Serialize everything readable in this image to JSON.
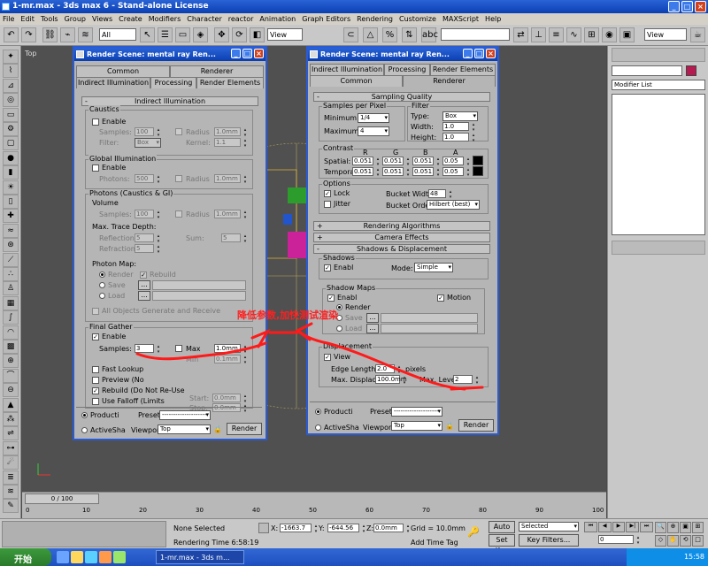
{
  "app": {
    "title": "1-mr.max - 3ds max 6 - Stand-alone License",
    "menu": [
      "File",
      "Edit",
      "Tools",
      "Group",
      "Views",
      "Create",
      "Modifiers",
      "Character",
      "reactor",
      "Animation",
      "Graph Editors",
      "Rendering",
      "Customize",
      "MAXScript",
      "Help"
    ]
  },
  "toolbar": {
    "selection_filter": "All",
    "ref_coord": "View",
    "right_view": "View"
  },
  "viewport": {
    "label": "Top"
  },
  "cmdpanel": {
    "modifier_list": "Modifier List"
  },
  "timeline": {
    "frame": "0 / 100",
    "ticks": [
      "0",
      "10",
      "20",
      "30",
      "40",
      "50",
      "60",
      "70",
      "80",
      "90",
      "100"
    ]
  },
  "status": {
    "selection": "None Selected",
    "prompt": "Rendering Time  6:58:19",
    "x": "-1663.7",
    "y": "-644.56",
    "z": "0.0mm",
    "grid": "Grid = 10.0mm",
    "add_time_tag": "Add Time Tag",
    "auto_key": "Auto Key",
    "selected": "Selected",
    "set_key": "Set Key",
    "key_filters": "Key Filters...",
    "frame_field": "0"
  },
  "taskbar": {
    "start": "开始",
    "task": "1-mr.max - 3ds m...",
    "clock": "15:58"
  },
  "dlg1": {
    "title": "Render Scene: mental ray Ren...",
    "tabs_top": [
      "Common",
      "Renderer"
    ],
    "tabs_bottom": [
      "Indirect Illumination",
      "Processing",
      "Render Elements"
    ],
    "rollout": "Indirect Illumination",
    "caustics": {
      "label": "Caustics",
      "enable": "Enable",
      "samples_label": "Samples:",
      "samples": "100",
      "radius_label": "Radius",
      "radius": "1.0mm",
      "filter_label": "Filter:",
      "filter": "Box",
      "kernel_label": "Kernel:",
      "kernel": "1.1"
    },
    "gi": {
      "label": "Global Illumination",
      "enable": "Enable",
      "photons_label": "Photons:",
      "photons": "500",
      "radius_label": "Radius",
      "radius": "1.0mm"
    },
    "photons": {
      "label": "Photons (Caustics & GI)",
      "volume": "Volume",
      "samples_label": "Samples:",
      "samples": "100",
      "radius_label": "Radius",
      "radius": "1.0mm",
      "max_trace": "Max. Trace Depth:",
      "reflections_label": "Reflections:",
      "reflections": "5",
      "sum_label": "Sum:",
      "sum": "5",
      "refractions_label": "Refractions:",
      "refractions": "5",
      "photon_map": "Photon Map:",
      "render": "Render",
      "rebuild": "Rebuild",
      "save": "Save",
      "load": "Load",
      "browse": "...",
      "all_objects": "All Objects Generate and Receive"
    },
    "fg": {
      "label": "Final Gather",
      "enable": "Enable",
      "samples_label": "Samples:",
      "samples": "3",
      "max_label": "Max",
      "max": "1.0mm",
      "min_label": "Min",
      "min": "0.1mm",
      "fast_lookup": "Fast Lookup",
      "preview": "Preview (No",
      "rebuild": "Rebuild (Do Not Re-Use",
      "use_falloff": "Use Falloff (Limits",
      "start_label": "Start:",
      "start": "0.0mm",
      "stop_label": "Stop:",
      "stop": "0.0mm"
    },
    "bottom": {
      "production": "Producti",
      "activeshade": "ActiveSha",
      "preset_label": "Preset:",
      "preset": "--------------------",
      "viewport_label": "Viewport:",
      "viewport": "Top",
      "render": "Render"
    }
  },
  "dlg2": {
    "title": "Render Scene: mental ray Ren...",
    "tabs_top": [
      "Indirect Illumination",
      "Processing",
      "Render Elements"
    ],
    "tabs_bottom": [
      "Common",
      "Renderer"
    ],
    "rollout": "Sampling Quality",
    "spp": {
      "label": "Samples per Pixel",
      "min_label": "Minimum:",
      "min": "1/4",
      "max_label": "Maximum:",
      "max": "4"
    },
    "filter": {
      "label": "Filter",
      "type_label": "Type:",
      "type": "Box",
      "width_label": "Width:",
      "width": "1.0",
      "height_label": "Height:",
      "height": "1.0"
    },
    "contrast": {
      "label": "Contrast",
      "cols": [
        "R",
        "G",
        "B",
        "A"
      ],
      "spatial_label": "Spatial:",
      "spatial": [
        "0.051",
        "0.051",
        "0.051",
        "0.05"
      ],
      "temporal_label": "Temporal:",
      "temporal": [
        "0.051",
        "0.051",
        "0.051",
        "0.05"
      ]
    },
    "options": {
      "label": "Options",
      "lock": "Lock",
      "jitter": "Jitter",
      "bucket_width_label": "Bucket Width:",
      "bucket_width": "48",
      "bucket_order_label": "Bucket Order:",
      "bucket_order": "Hilbert (best)"
    },
    "rollouts": [
      "Rendering Algorithms",
      "Camera Effects",
      "Shadows & Displacement"
    ],
    "shadows": {
      "label": "Shadows",
      "enable": "Enabl",
      "mode_label": "Mode:",
      "mode": "Simple"
    },
    "shadow_maps": {
      "label": "Shadow Maps",
      "enable": "Enabl",
      "motion": "Motion",
      "render": "Render",
      "save": "Save",
      "load": "Load",
      "browse": "..."
    },
    "displacement": {
      "label": "Displacement",
      "view": "View",
      "edge_label": "Edge Length:",
      "edge": "2.0",
      "pixels": "pixels",
      "max_disp_label": "Max. Displace:",
      "max_disp": "100.0mm",
      "max_level_label": "Max. Level:",
      "max_level": "2"
    },
    "bottom": {
      "production": "Producti",
      "activeshade": "ActiveSha",
      "preset_label": "Preset:",
      "preset": "--------------------",
      "viewport_label": "Viewport:",
      "viewport": "Top",
      "render": "Render"
    }
  },
  "annotation": "降低参数,加快测试渲染"
}
